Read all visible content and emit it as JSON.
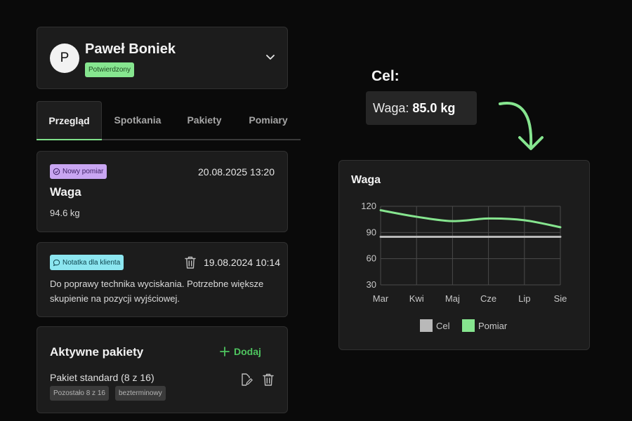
{
  "profile": {
    "initial": "P",
    "name": "Paweł Boniek",
    "status": "Potwierdzony"
  },
  "tabs": [
    {
      "label": "Przegląd",
      "active": true
    },
    {
      "label": "Spotkania",
      "active": false
    },
    {
      "label": "Pakiety",
      "active": false
    },
    {
      "label": "Pomiary",
      "active": false
    }
  ],
  "measurement": {
    "badge": "Nowy pomiar",
    "date": "20.08.2025 13:20",
    "title": "Waga",
    "value": "94.6 kg"
  },
  "note": {
    "badge": "Notatka dla klienta",
    "date": "19.08.2024 10:14",
    "text": "Do poprawy technika wyciskania. Potrzebne większe skupienie na pozycji wyjściowej."
  },
  "packages": {
    "title": "Aktywne pakiety",
    "add_label": "Dodaj",
    "items": [
      {
        "name": "Pakiet standard (8 z 16)",
        "chips": [
          "Pozostało 8 z 16",
          "bezterminowy"
        ]
      }
    ]
  },
  "goal": {
    "heading": "Cel:",
    "label": "Waga:",
    "value": "85.0 kg"
  },
  "colors": {
    "accent_green": "#86e58f",
    "target_gray": "#b9b9b9",
    "card_bg": "#1c1c1c"
  },
  "chart_data": {
    "type": "line",
    "title": "Waga",
    "categories": [
      "Mar",
      "Kwi",
      "Maj",
      "Cze",
      "Lip",
      "Sie"
    ],
    "yticks": [
      120,
      90,
      60,
      30
    ],
    "ylim": [
      30,
      120
    ],
    "series": [
      {
        "name": "Cel",
        "color": "#b9b9b9",
        "values": [
          85,
          85,
          85,
          85,
          85,
          85
        ]
      },
      {
        "name": "Pomiar",
        "color": "#86e58f",
        "values": [
          115.5,
          108,
          103,
          106,
          104,
          96
        ]
      }
    ],
    "grid": true,
    "legend": "bottom"
  }
}
